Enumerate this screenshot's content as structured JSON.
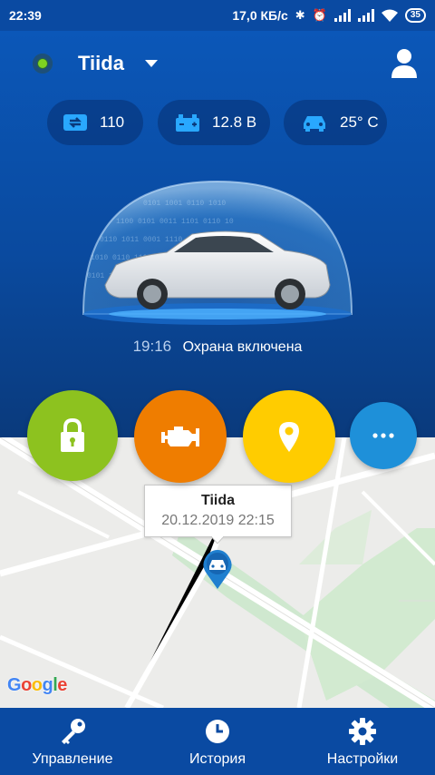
{
  "status_bar": {
    "time": "22:39",
    "network_speed": "17,0 КБ/с",
    "battery": "35"
  },
  "header": {
    "car_name": "Tiida",
    "online_indicator_color": "#7ed321"
  },
  "chips": [
    {
      "icon": "engine-hours-icon",
      "value": "110"
    },
    {
      "icon": "battery-icon",
      "value": "12.8 В"
    },
    {
      "icon": "car-temperature-icon",
      "value": "25° C"
    }
  ],
  "security": {
    "time": "19:16",
    "status": "Охрана включена"
  },
  "actions": [
    {
      "icon": "lock-icon",
      "color": "#8dc21f"
    },
    {
      "icon": "engine-icon",
      "color": "#ef7d00"
    },
    {
      "icon": "location-pin-icon",
      "color": "#ffcc00"
    },
    {
      "icon": "more-icon",
      "color": "#1e90d9"
    }
  ],
  "map": {
    "callout_title": "Tiida",
    "callout_datetime": "20.12.2019 22:15",
    "provider": "Google"
  },
  "bottom_nav": [
    {
      "icon": "key-icon",
      "label": "Управление"
    },
    {
      "icon": "clock-icon",
      "label": "История"
    },
    {
      "icon": "gear-icon",
      "label": "Настройки"
    }
  ]
}
